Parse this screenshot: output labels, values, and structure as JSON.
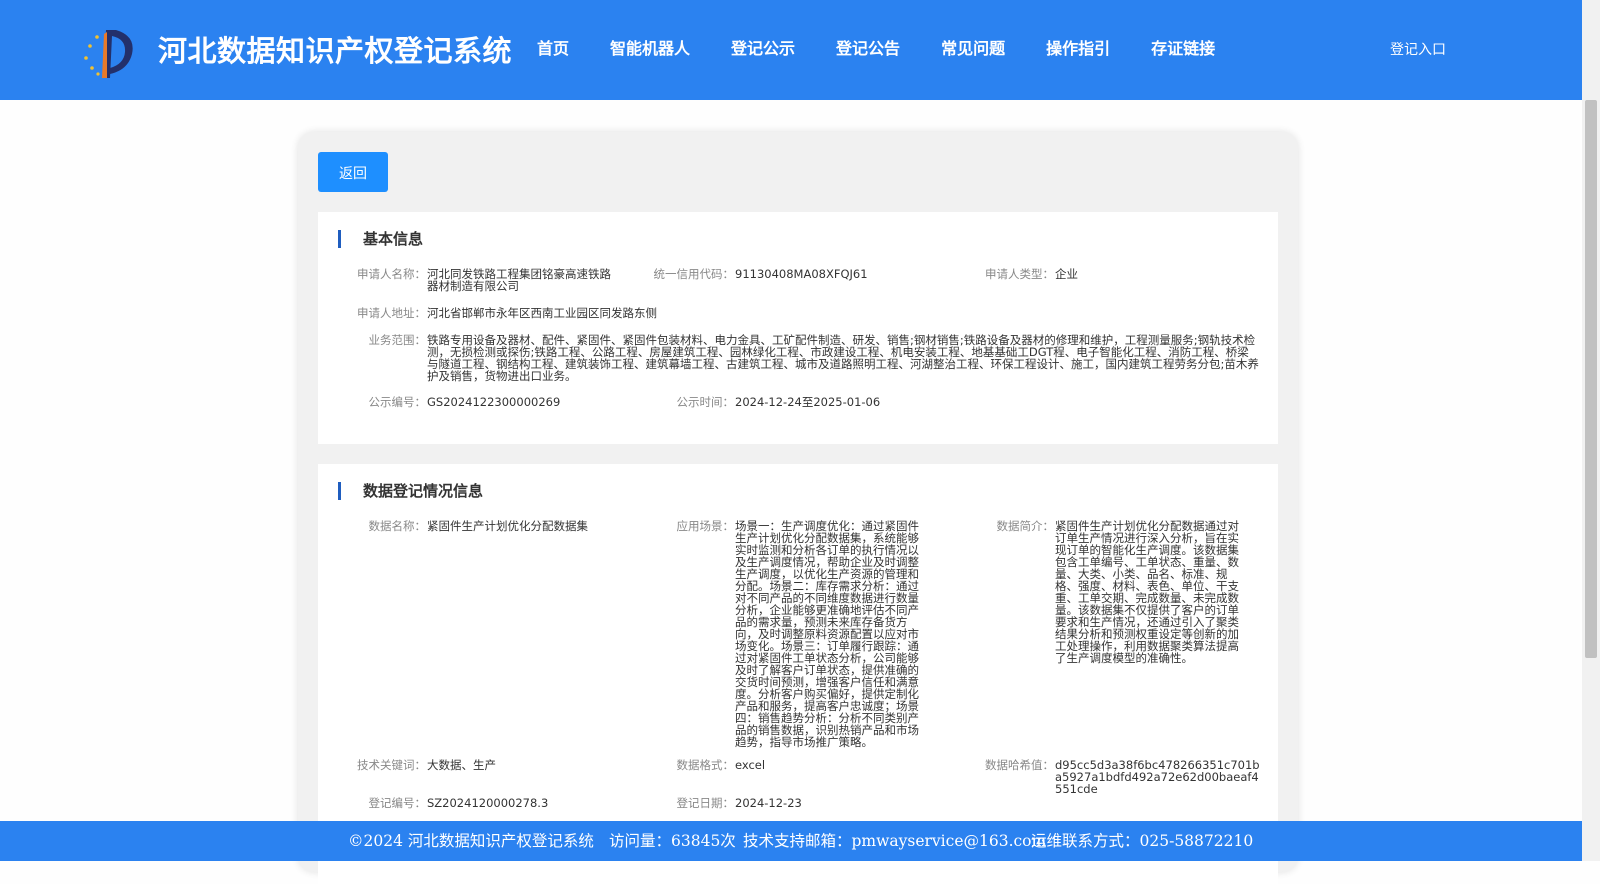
{
  "header": {
    "title": "河北数据知识产权登记系统",
    "nav": [
      "首页",
      "智能机器人",
      "登记公示",
      "登记公告",
      "常见问题",
      "操作指引",
      "存证链接"
    ],
    "login": "登记入口"
  },
  "back_label": "返回",
  "basic": {
    "title": "基本信息",
    "applicant_name": {
      "label": "申请人名称：",
      "value": "河北同发铁路工程集团铭豪高速铁路器材制造有限公司"
    },
    "credit_code": {
      "label": "统一信用代码：",
      "value": "91130408MA08XFQJ61"
    },
    "applicant_type": {
      "label": "申请人类型：",
      "value": "企业"
    },
    "address": {
      "label": "申请人地址：",
      "value": "河北省邯郸市永年区西南工业园区同发路东侧"
    },
    "business_scope": {
      "label": "业务范围：",
      "value": "铁路专用设备及器材、配件、紧固件、紧固件包装材料、电力金具、工矿配件制造、研发、销售;钢材销售;铁路设备及器材的修理和维护，工程测量服务;钢轨技术检测，无损检测或探伤;铁路工程、公路工程、房屋建筑工程、园林绿化工程、市政建设工程、机电安装工程、地基基础工DGT程、电子智能化工程、消防工程、桥梁与隧道工程、钢结构工程、建筑装饰工程、建筑幕墙工程、古建筑工程、城市及道路照明工程、河湖整治工程、环保工程设计、施工，国内建筑工程劳务分包;苗木养护及销售，货物进出口业务。"
    },
    "public_no": {
      "label": "公示编号：",
      "value": "GS2024122300000269"
    },
    "public_time": {
      "label": "公示时间：",
      "value": "2024-12-24至2025-01-06"
    }
  },
  "data_reg": {
    "title": "数据登记情况信息",
    "data_name": {
      "label": "数据名称：",
      "value": "紧固件生产计划优化分配数据集"
    },
    "scenario": {
      "label": "应用场景：",
      "value": "场景一：生产调度优化：通过紧固件生产计划优化分配数据集，系统能够实时监测和分析各订单的执行情况以及生产调度情况，帮助企业及时调整生产调度，以优化生产资源的管理和分配。场景二：库存需求分析：通过对不同产品的不同维度数据进行数量分析，企业能够更准确地评估不同产品的需求量，预测未来库存备货方向，及时调整原料资源配置以应对市场变化。场景三：订单履行跟踪：通过对紧固件工单状态分析，公司能够及时了解客户订单状态，提供准确的交货时间预测，增强客户信任和满意度。分析客户购买偏好，提供定制化产品和服务，提高客户忠诚度；场景四：销售趋势分析：分析不同类别产品的销售数据，识别热销产品和市场趋势，指导市场推广策略。"
    },
    "summary": {
      "label": "数据简介：",
      "value": "紧固件生产计划优化分配数据通过对订单生产情况进行深入分析，旨在实现订单的智能化生产调度。该数据集包含工单编号、工单状态、重量、数量、大类、小类、品名、标准、规格、强度、材料、表色、单位、干支重、工单交期、完成数量、未完成数量。该数据集不仅提供了客户的订单要求和生产情况，还通过引入了聚类结果分析和预测权重设定等创新的加工处理操作，利用数据聚类算法提高了生产调度模型的准确性。"
    },
    "keywords": {
      "label": "技术关键词：",
      "value": "大数据、生产"
    },
    "format": {
      "label": "数据格式：",
      "value": "excel"
    },
    "hash": {
      "label": "数据哈希值：",
      "value": "d95cc5d3a38f6bc478266351c701ba5927a1bdfd492a72e62d00baeaf4551cde"
    },
    "reg_no": {
      "label": "登记编号：",
      "value": "SZ2024120000278.3"
    },
    "reg_date": {
      "label": "登记日期：",
      "value": "2024-12-23"
    }
  },
  "footer": {
    "copyright": "©2024 河北数据知识产权登记系统",
    "visits": "访问量：63845次",
    "email": "技术支持邮箱：pmwayservice@163.com",
    "phone": "运维联系方式：025-58872210"
  },
  "colors": {
    "primary": "#2b82f0",
    "button": "#1e8fff",
    "accent_bar": "#1f5dbf"
  }
}
